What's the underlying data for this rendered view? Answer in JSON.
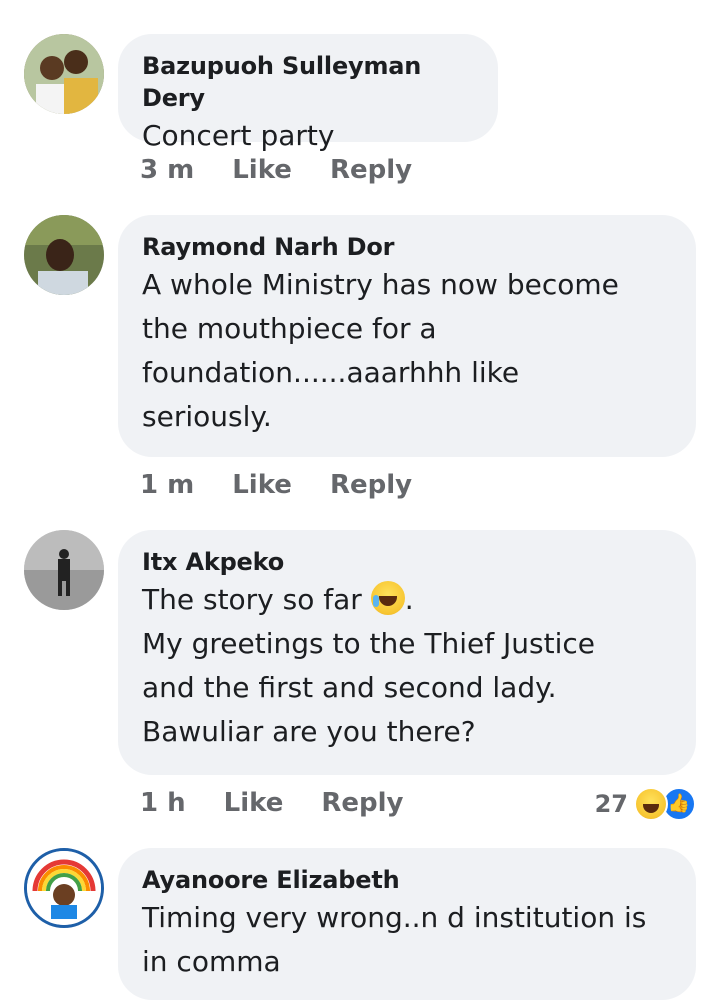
{
  "comments": [
    {
      "author": "Bazupuoh Sulleyman Dery",
      "text": "Concert party",
      "time": "3 m",
      "like_label": "Like",
      "reply_label": "Reply"
    },
    {
      "author": "Raymond Narh Dor",
      "text": "A whole Ministry has now become\nthe mouthpiece for a\nfoundation......aaarhhh like\nseriously.",
      "time": "1 m",
      "like_label": "Like",
      "reply_label": "Reply"
    },
    {
      "author": "Itx Akpeko",
      "text_line1": "The story so far ",
      "text_line1_end": ".",
      "text_rest": "My greetings to the Thief Justice\nand the first and second lady.\nBawuliar are you there?",
      "time": "1 h",
      "like_label": "Like",
      "reply_label": "Reply",
      "reaction_count": "27"
    },
    {
      "author": "Ayanoore Elizabeth",
      "text": "Timing very wrong..n d institution is\nin comma",
      "time": "",
      "like_label": "",
      "reply_label": ""
    }
  ]
}
